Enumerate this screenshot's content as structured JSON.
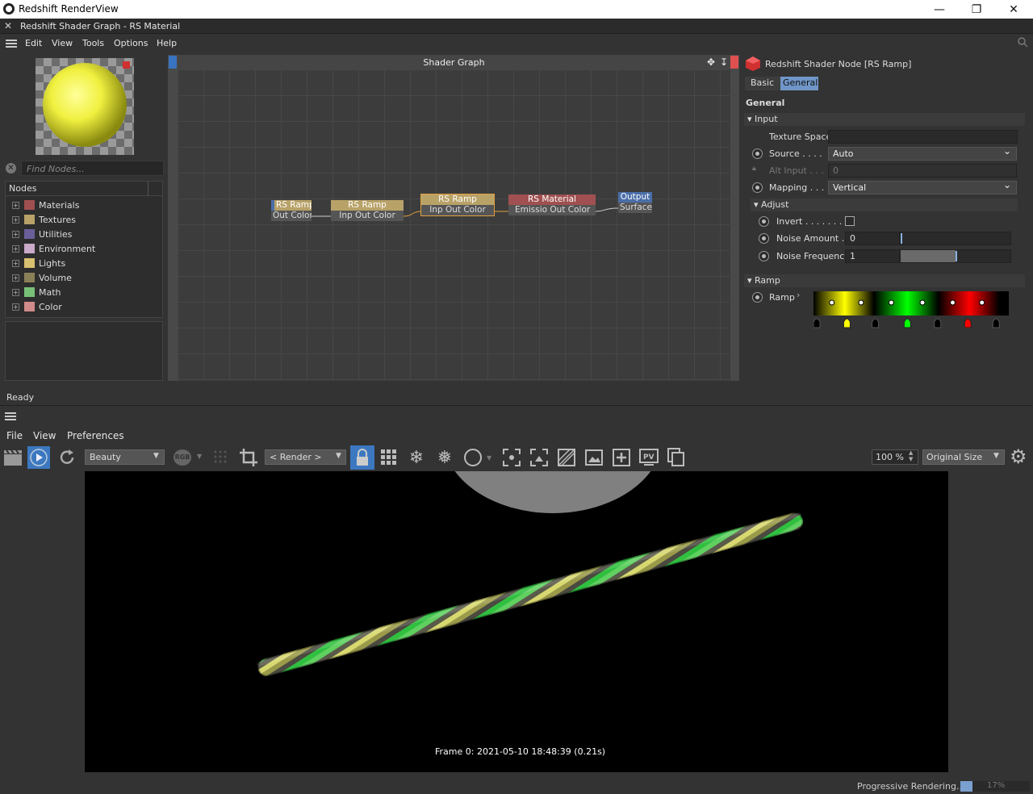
{
  "titlebar": {
    "title": "Redshift RenderView",
    "minimize": "—",
    "restore": "❐",
    "close": "✕"
  },
  "tab": {
    "close": "✕",
    "title": "Redshift Shader Graph - RS Material"
  },
  "menu": [
    "Edit",
    "View",
    "Tools",
    "Options",
    "Help"
  ],
  "find": {
    "placeholder": "Find Nodes..."
  },
  "nodes_tree": {
    "header": "Nodes",
    "items": [
      {
        "label": "Materials",
        "color": "#a05050"
      },
      {
        "label": "Textures",
        "color": "#b8a268"
      },
      {
        "label": "Utilities",
        "color": "#6a5f9a"
      },
      {
        "label": "Environment",
        "color": "#c9aac9"
      },
      {
        "label": "Lights",
        "color": "#d8c070"
      },
      {
        "label": "Volume",
        "color": "#8a8058"
      },
      {
        "label": "Math",
        "color": "#78c078"
      },
      {
        "label": "Color",
        "color": "#d08a8a"
      }
    ]
  },
  "graph": {
    "title": "Shader Graph",
    "nodes": [
      {
        "title": "RS Ramp",
        "ports": "Out Color",
        "head": "#b8a268"
      },
      {
        "title": "RS Ramp",
        "ports": "Inp Out Color",
        "head": "#b8a268"
      },
      {
        "title": "RS Ramp",
        "ports": "Inp Out Color",
        "head": "#b8a268"
      },
      {
        "title": "RS Material",
        "ports": "Emissio Out Color",
        "head": "#a05050"
      },
      {
        "title": "Output",
        "ports": "Surface",
        "head": "#4a6fa8"
      }
    ]
  },
  "props": {
    "header": "Redshift Shader Node [RS Ramp]",
    "tabs": [
      "Basic",
      "General"
    ],
    "active_tab": "General",
    "section": "General",
    "input_group": "Input",
    "texture_space_label": "Texture Space",
    "source_label": "Source . . . .",
    "source_value": "Auto",
    "alt_input_label": "Alt Input . . .",
    "alt_input_value": "0",
    "mapping_label": "Mapping . . .",
    "mapping_value": "Vertical",
    "adjust_group": "Adjust",
    "invert_label": "Invert . . . . . . .",
    "noise_amount_label": "Noise Amount .",
    "noise_amount_value": "0",
    "noise_freq_label": "Noise Frequency",
    "noise_freq_value": "1",
    "ramp_group": "Ramp",
    "ramp_label": "Ramp",
    "ramp_stops": [
      {
        "position": 0.0,
        "color": "#000000"
      },
      {
        "position": 0.16,
        "color": "#ffff00"
      },
      {
        "position": 0.31,
        "color": "#000000"
      },
      {
        "position": 0.48,
        "color": "#00ff00"
      },
      {
        "position": 0.64,
        "color": "#000000"
      },
      {
        "position": 0.8,
        "color": "#ff0000"
      },
      {
        "position": 0.95,
        "color": "#000000"
      }
    ]
  },
  "status": "Ready",
  "renderview": {
    "menu": [
      "File",
      "View",
      "Preferences"
    ],
    "aov": "Beauty",
    "rgb": "RGB",
    "render_camera": "< Render >",
    "zoom": "100 %",
    "size_mode": "Original Size",
    "frame_info": "Frame  0:  2021-05-10  18:48:39  (0.21s)",
    "progress_label": "Progressive Rendering...",
    "progress_value": "17%",
    "progress_fraction": 0.17
  }
}
